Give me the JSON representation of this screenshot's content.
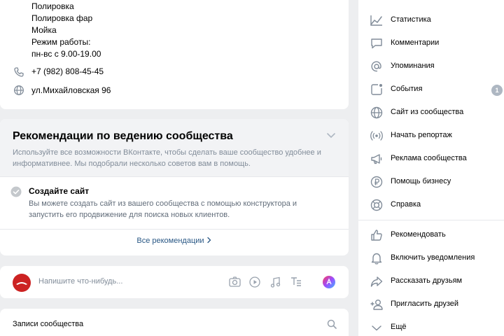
{
  "info": {
    "lines": [
      "Полировка",
      "Полировка фар",
      "Мойка",
      "Режим работы:",
      "пн-вс с 9.00-19.00"
    ],
    "phone": "+7 (982) 808-45-45",
    "address": "ул.Михайловская 96"
  },
  "recommendations": {
    "title": "Рекомендации по ведению сообщества",
    "description": "Используйте все возможности ВКонтакте, чтобы сделать ваше сообщество удобнее и информативнее. Мы подобрали несколько советов вам в помощь.",
    "item_title": "Создайте сайт",
    "item_description": "Вы можете создать сайт из вашего сообщества с помощью конструктора и запустить его продвижение для поиска новых клиентов.",
    "all_link": "Все рекомендации"
  },
  "composer": {
    "placeholder": "Напишите что-нибудь..."
  },
  "posts": {
    "title": "Записи сообщества"
  },
  "menu": {
    "items": [
      {
        "label": "Статистика",
        "icon": "statistics-icon"
      },
      {
        "label": "Комментарии",
        "icon": "comment-icon"
      },
      {
        "label": "Упоминания",
        "icon": "at-icon"
      },
      {
        "label": "События",
        "icon": "events-icon",
        "badge": "1"
      },
      {
        "label": "Сайт из сообщества",
        "icon": "globe-icon"
      },
      {
        "label": "Начать репортаж",
        "icon": "broadcast-icon"
      },
      {
        "label": "Реклама сообщества",
        "icon": "megaphone-icon"
      },
      {
        "label": "Помощь бизнесу",
        "icon": "ruble-icon"
      },
      {
        "label": "Справка",
        "icon": "help-icon"
      },
      {
        "label": "Рекомендовать",
        "icon": "like-icon"
      },
      {
        "label": "Включить уведомления",
        "icon": "bell-icon"
      },
      {
        "label": "Рассказать друзьям",
        "icon": "share-icon"
      },
      {
        "label": "Пригласить друзей",
        "icon": "add-friend-icon"
      },
      {
        "label": "Ещё",
        "icon": "chevron-down-icon"
      }
    ]
  },
  "colors": {
    "background": "#edeef0",
    "link": "#2a5885",
    "icon": "#818c99",
    "accent_red": "#cc2222"
  }
}
